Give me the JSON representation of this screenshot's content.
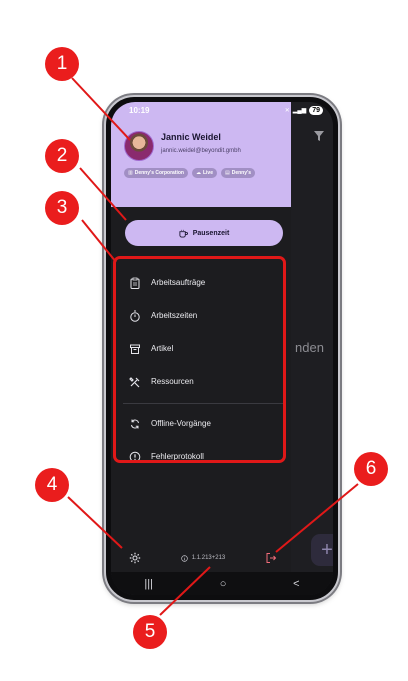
{
  "status_bar": {
    "time": "10:19",
    "battery": "79"
  },
  "header": {
    "user_name": "Jannic Weidel",
    "user_email": "jannic.weidel@beyondit.gmbh",
    "chips": [
      {
        "icon": "building-icon",
        "glyph": "▥",
        "label": "Denny's Corporation"
      },
      {
        "icon": "cloud-icon",
        "glyph": "☁",
        "label": "Live"
      },
      {
        "icon": "store-icon",
        "glyph": "▤",
        "label": "Denny's"
      }
    ]
  },
  "pause_button": {
    "label": "Pausenzeit",
    "icon": "coffee-icon"
  },
  "menu": {
    "items": [
      {
        "label": "Arbeitsaufträge",
        "icon": "clipboard-icon"
      },
      {
        "label": "Arbeitszeiten",
        "icon": "stopwatch-icon"
      },
      {
        "label": "Artikel",
        "icon": "archive-box-icon"
      },
      {
        "label": "Ressourcen",
        "icon": "tools-icon"
      }
    ],
    "secondary_items": [
      {
        "label": "Offline-Vorgänge",
        "icon": "sync-icon"
      },
      {
        "label": "Fehlerprotokoll",
        "icon": "error-circle-icon"
      }
    ]
  },
  "footer": {
    "version": "1.1.213+213"
  },
  "background": {
    "partial_text": "nden",
    "fab_label": "+"
  },
  "navbar": {
    "recents": "|||",
    "home": "○",
    "back": "<"
  },
  "callouts": [
    "1",
    "2",
    "3",
    "4",
    "5",
    "6"
  ],
  "colors": {
    "accent": "#cdb8f2",
    "callout": "#ea1d1d",
    "drawer_bg": "#1c1c1f"
  }
}
